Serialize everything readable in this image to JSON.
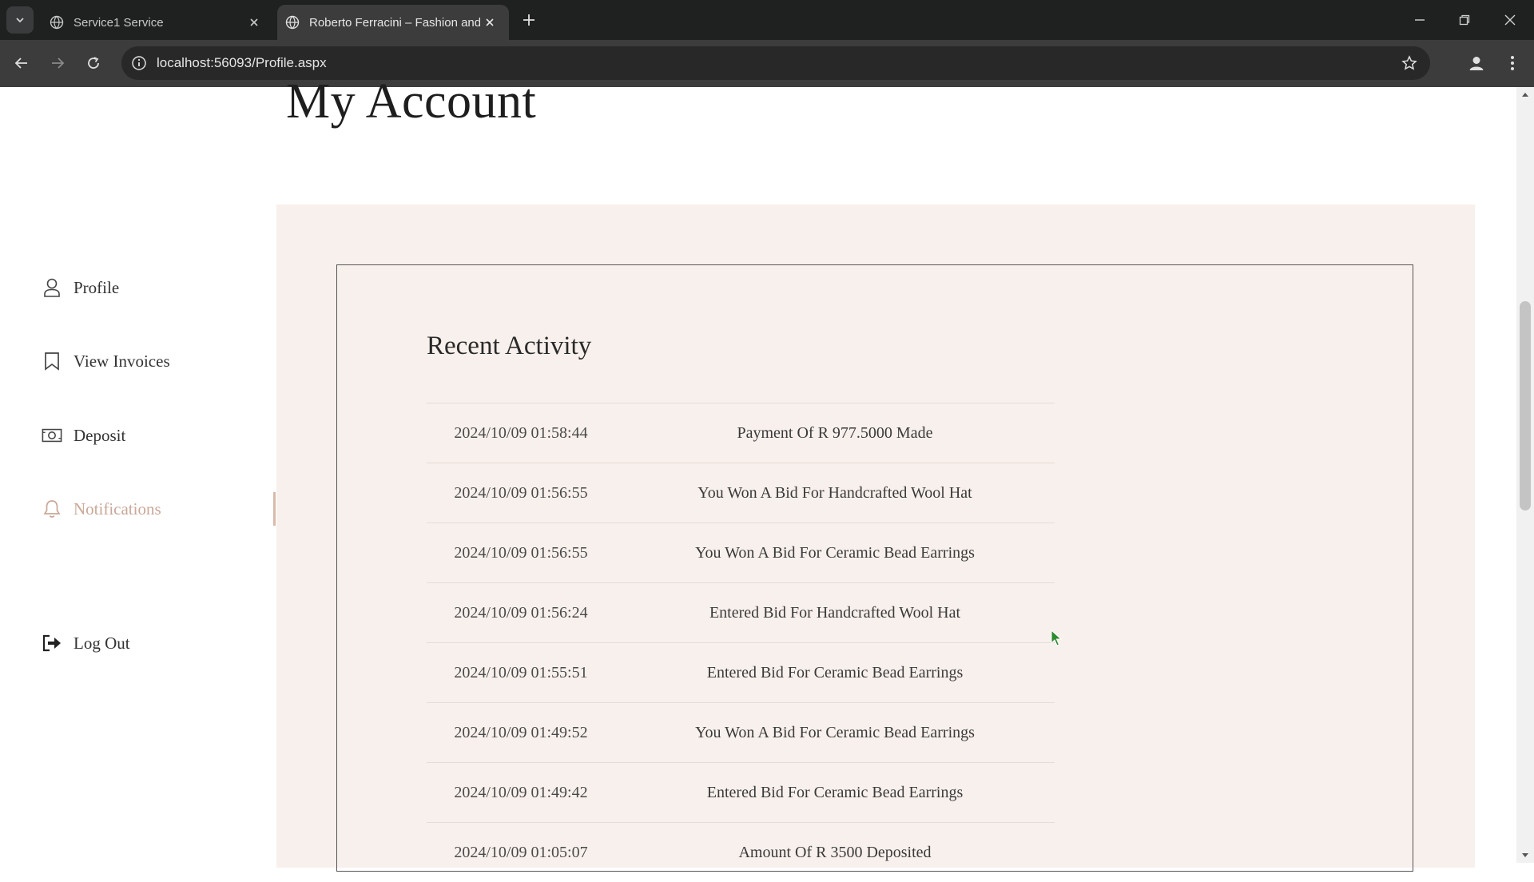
{
  "browser": {
    "tabs": [
      {
        "title": "Service1 Service",
        "active": false
      },
      {
        "title": "Roberto Ferracini – Fashion and",
        "active": true
      }
    ],
    "url": "localhost:56093/Profile.aspx"
  },
  "page": {
    "title": "My Account"
  },
  "sidebar": {
    "items": [
      {
        "label": "Profile",
        "icon": "user-icon"
      },
      {
        "label": "View Invoices",
        "icon": "bookmark-icon"
      },
      {
        "label": "Deposit",
        "icon": "cash-icon"
      },
      {
        "label": "Notifications",
        "icon": "bell-icon",
        "active": true
      },
      {
        "label": "Log Out",
        "icon": "logout-icon"
      }
    ]
  },
  "activity": {
    "title": "Recent Activity",
    "rows": [
      {
        "date": "2024/10/09 01:58:44",
        "message": "Payment Of R 977.5000 Made"
      },
      {
        "date": "2024/10/09 01:56:55",
        "message": "You Won A Bid For Handcrafted Wool Hat"
      },
      {
        "date": "2024/10/09 01:56:55",
        "message": "You Won A Bid For Ceramic Bead Earrings"
      },
      {
        "date": "2024/10/09 01:56:24",
        "message": "Entered Bid For Handcrafted Wool Hat"
      },
      {
        "date": "2024/10/09 01:55:51",
        "message": "Entered Bid For Ceramic Bead Earrings"
      },
      {
        "date": "2024/10/09 01:49:52",
        "message": "You Won A Bid For Ceramic Bead Earrings"
      },
      {
        "date": "2024/10/09 01:49:42",
        "message": "Entered Bid For Ceramic Bead Earrings"
      },
      {
        "date": "2024/10/09 01:05:07",
        "message": "Amount Of R 3500 Deposited"
      }
    ]
  },
  "colors": {
    "panel_bg": "#f8f0ec",
    "active_nav": "#c9a898",
    "chrome_dark": "#1f2020",
    "chrome_toolbar": "#3c3c3c"
  }
}
